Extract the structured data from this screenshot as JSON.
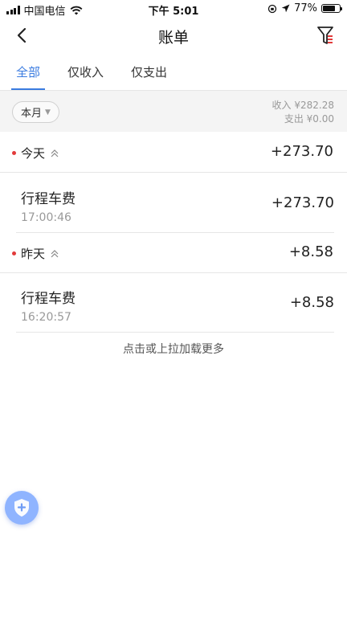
{
  "status_bar": {
    "carrier": "中国电信",
    "time": "下午 5:01",
    "battery": "77%",
    "battery_level": 0.77
  },
  "nav": {
    "title": "账单"
  },
  "tabs": [
    {
      "label": "全部",
      "active": true
    },
    {
      "label": "仅收入",
      "active": false
    },
    {
      "label": "仅支出",
      "active": false
    }
  ],
  "summary": {
    "period": "本月",
    "income": "收入 ¥282.28",
    "expense": "支出 ¥0.00"
  },
  "days": [
    {
      "label": "今天",
      "total": "+273.70",
      "transactions": [
        {
          "title": "行程车费",
          "time": "17:00:46",
          "amount": "+273.70"
        }
      ]
    },
    {
      "label": "昨天",
      "total": "+8.58",
      "transactions": [
        {
          "title": "行程车费",
          "time": "16:20:57",
          "amount": "+8.58"
        }
      ]
    }
  ],
  "load_more": "点击或上拉加载更多",
  "colors": {
    "accent": "#3a7be0",
    "dot": "#e23a3a",
    "fab": "#8fb4ff"
  }
}
